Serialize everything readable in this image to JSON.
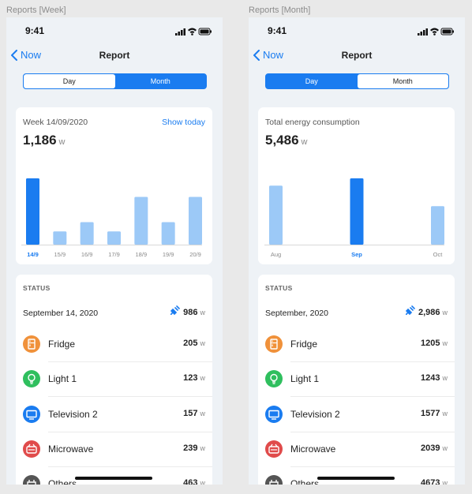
{
  "frames": [
    {
      "label": "Reports [Week]",
      "time": "9:41",
      "back_label": "Now",
      "title": "Report",
      "seg_day": "Day",
      "seg_month": "Month",
      "active_segment": "day",
      "chart_header": "Week 14/09/2020",
      "show_today": "Show today",
      "total": "1,186",
      "unit": "w",
      "status_label": "STATUS",
      "status_date": "September 14, 2020",
      "status_value": "986",
      "devices": [
        {
          "name": "Fridge",
          "value": "205",
          "icon": "fridge-icon",
          "color": "#f0913a"
        },
        {
          "name": "Light 1",
          "value": "123",
          "icon": "bulb-icon",
          "color": "#2fbf5e"
        },
        {
          "name": "Television 2",
          "value": "157",
          "icon": "tv-icon",
          "color": "#1a7cf0"
        },
        {
          "name": "Microwave",
          "value": "239",
          "icon": "microwave-icon",
          "color": "#e04b4b"
        },
        {
          "name": "Others",
          "value": "463",
          "icon": "plug-icon",
          "color": "#555555"
        }
      ]
    },
    {
      "label": "Reports [Month]",
      "time": "9:41",
      "back_label": "Now",
      "title": "Report",
      "seg_day": "Day",
      "seg_month": "Month",
      "active_segment": "month",
      "chart_header": "Total energy consumption",
      "show_today": "",
      "total": "5,486",
      "unit": "w",
      "status_label": "STATUS",
      "status_date": "September, 2020",
      "status_value": "2,986",
      "devices": [
        {
          "name": "Fridge",
          "value": "1205",
          "icon": "fridge-icon",
          "color": "#f0913a"
        },
        {
          "name": "Light 1",
          "value": "1243",
          "icon": "bulb-icon",
          "color": "#2fbf5e"
        },
        {
          "name": "Television 2",
          "value": "1577",
          "icon": "tv-icon",
          "color": "#1a7cf0"
        },
        {
          "name": "Microwave",
          "value": "2039",
          "icon": "microwave-icon",
          "color": "#e04b4b"
        },
        {
          "name": "Others",
          "value": "4673",
          "icon": "plug-icon",
          "color": "#555555"
        }
      ]
    }
  ],
  "colors": {
    "accent": "#1a7cf0",
    "bar_light": "#9cc9f7",
    "bar_active": "#1a7cf0"
  },
  "chart_data": [
    {
      "type": "bar",
      "categories": [
        "14/9",
        "15/9",
        "16/9",
        "17/9",
        "18/9",
        "19/9",
        "20/9"
      ],
      "values": [
        100,
        20,
        34,
        20,
        72,
        34,
        72
      ],
      "highlight_index": 0,
      "ylim": [
        0,
        100
      ]
    },
    {
      "type": "bar",
      "categories": [
        "Aug",
        "Sep",
        "Oct"
      ],
      "values": [
        89,
        100,
        58
      ],
      "highlight_index": 1,
      "ylim": [
        0,
        100
      ]
    }
  ]
}
